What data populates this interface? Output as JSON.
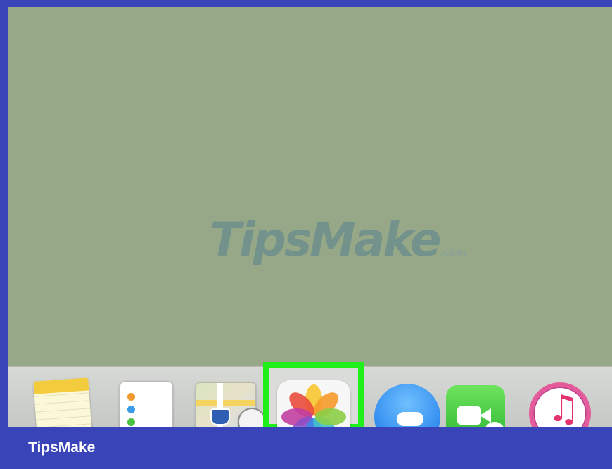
{
  "desktop": {
    "watermark": {
      "part1": "Tips",
      "part2": "Make",
      "suffix": ".com"
    }
  },
  "dock": {
    "apps": [
      "notes-icon",
      "reminders-icon",
      "maps-icon",
      "photos-icon",
      "messages-icon",
      "facetime-icon",
      "itunes-icon"
    ],
    "highlighted_app": "photos-icon",
    "highlight_color": "#1ff01a"
  },
  "footer": {
    "brand": "TipsMake",
    "background": "#3a44b9"
  }
}
